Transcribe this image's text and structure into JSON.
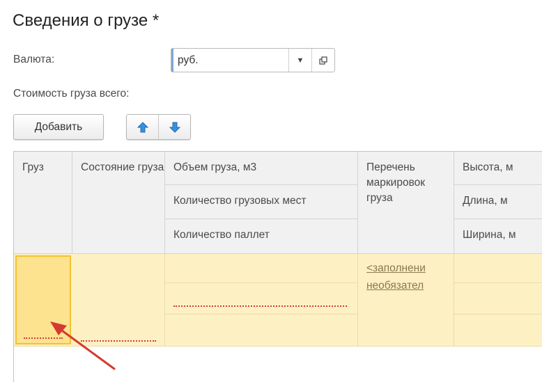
{
  "header": {
    "title": "Сведения о грузе *"
  },
  "currency": {
    "label": "Валюта:",
    "value": "руб.",
    "dropdown_icon": "▾"
  },
  "total_cost": {
    "label": "Стоимость груза всего:"
  },
  "toolbar": {
    "add_label": "Добавить",
    "up_icon": "arrow-up-icon",
    "down_icon": "arrow-down-icon"
  },
  "grid": {
    "headers": {
      "cargo": "Груз",
      "state": "Состояние груза",
      "volume": "Объем груза, м3",
      "packages": "Количество грузовых мест",
      "pallets": "Количество паллет",
      "markings": "Перечень маркировок груза",
      "height": "Высота, м",
      "length": "Длина, м",
      "width": "Ширина, м"
    },
    "row": {
      "markings_link_1": "<заполнени",
      "markings_link_2": "необязател"
    }
  },
  "colors": {
    "accent": "#2a7fd0",
    "row_highlight": "#fdf0c2",
    "selected_cell": "#fde38f",
    "required_mark": "#d63a3a",
    "annotation_arrow": "#d43a2f"
  }
}
